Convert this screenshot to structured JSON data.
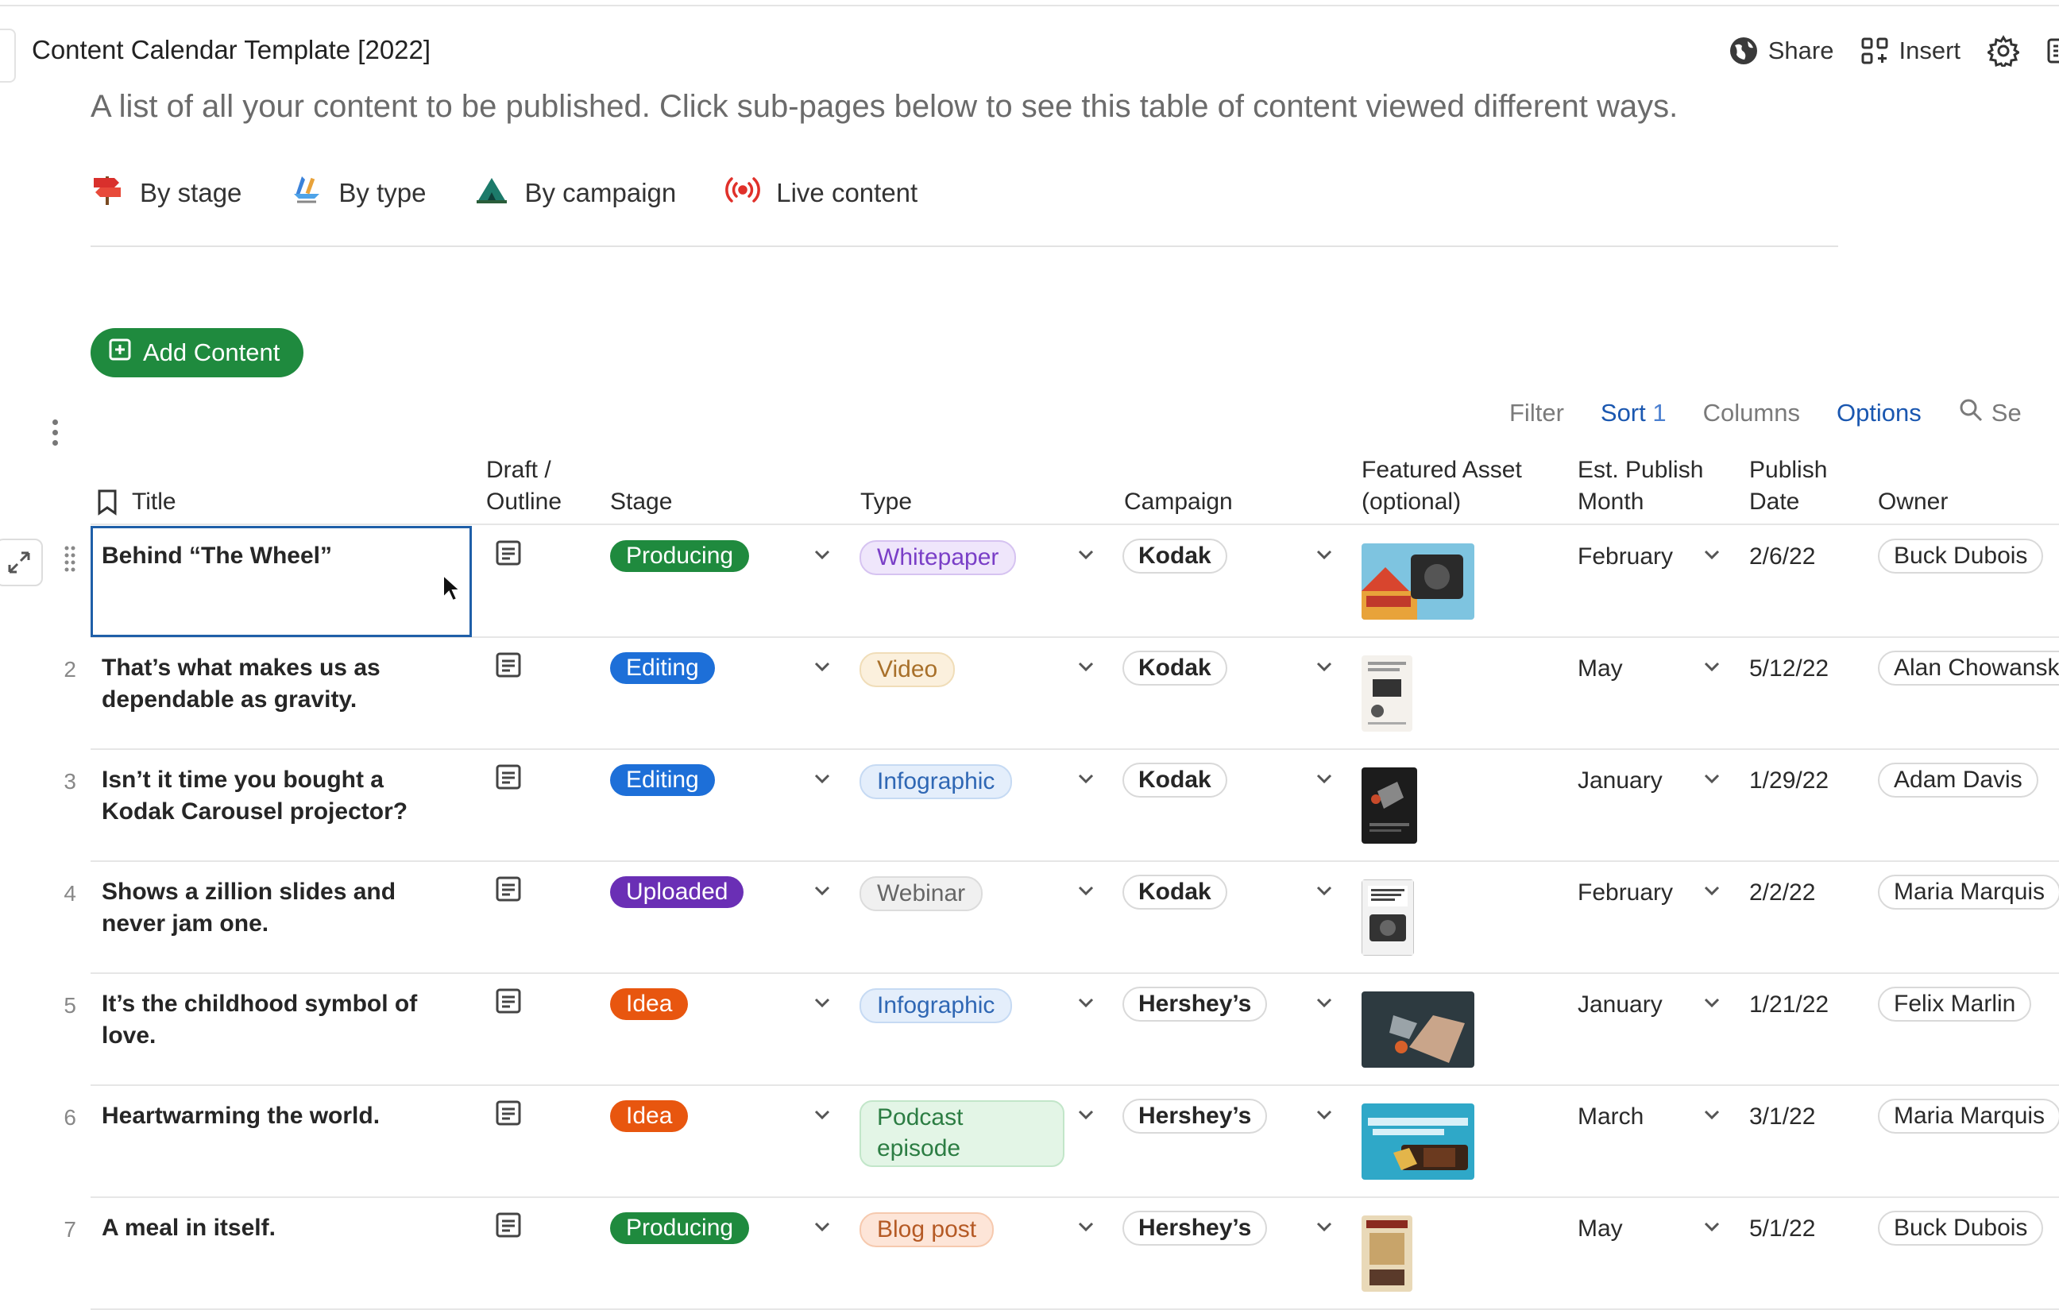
{
  "header": {
    "title": "Content Calendar Template [2022]",
    "share_label": "Share",
    "insert_label": "Insert"
  },
  "subtitle": "A list of all your content to be published. Click sub-pages below to see this table of content viewed different ways.",
  "views": [
    {
      "label": "By stage",
      "icon": "signpost-icon"
    },
    {
      "label": "By type",
      "icon": "tools-icon"
    },
    {
      "label": "By campaign",
      "icon": "tent-icon"
    },
    {
      "label": "Live content",
      "icon": "broadcast-icon"
    }
  ],
  "add_button_label": "Add Content",
  "toolbar": {
    "filter": "Filter",
    "sort": "Sort",
    "sort_count": "1",
    "columns": "Columns",
    "options": "Options",
    "search": "Se"
  },
  "columns": {
    "title": "Title",
    "draft_1": "Draft /",
    "draft_2": "Outline",
    "stage": "Stage",
    "type": "Type",
    "campaign": "Campaign",
    "asset_1": "Featured Asset",
    "asset_2": "(optional)",
    "month_1": "Est. Publish",
    "month_2": "Month",
    "date_1": "Publish",
    "date_2": "Date",
    "owner": "Owner"
  },
  "rows": [
    {
      "num": "",
      "title": "Behind “The Wheel”",
      "stage": "Producing",
      "type": "Whitepaper",
      "campaign": "Kodak",
      "month": "February",
      "date": "2/6/22",
      "owner": "Buck Dubois"
    },
    {
      "num": "2",
      "title": "That’s what makes us as dependable as gravity.",
      "stage": "Editing",
      "type": "Video",
      "campaign": "Kodak",
      "month": "May",
      "date": "5/12/22",
      "owner": "Alan Chowansky"
    },
    {
      "num": "3",
      "title": "Isn’t it time you bought a Kodak Carousel projector?",
      "stage": "Editing",
      "type": "Infographic",
      "campaign": "Kodak",
      "month": "January",
      "date": "1/29/22",
      "owner": "Adam Davis"
    },
    {
      "num": "4",
      "title": "Shows a zillion slides and never jam one.",
      "stage": "Uploaded",
      "type": "Webinar",
      "campaign": "Kodak",
      "month": "February",
      "date": "2/2/22",
      "owner": "Maria Marquis"
    },
    {
      "num": "5",
      "title": "It’s the childhood symbol of love.",
      "stage": "Idea",
      "type": "Infographic",
      "campaign": "Hershey’s",
      "month": "January",
      "date": "1/21/22",
      "owner": "Felix Marlin"
    },
    {
      "num": "6",
      "title": "Heartwarming the world.",
      "stage": "Idea",
      "type": "Podcast episode",
      "campaign": "Hershey’s",
      "month": "March",
      "date": "3/1/22",
      "owner": "Maria Marquis"
    },
    {
      "num": "7",
      "title": "A meal in itself.",
      "stage": "Producing",
      "type": "Blog post",
      "campaign": "Hershey’s",
      "month": "May",
      "date": "5/1/22",
      "owner": "Buck Dubois"
    }
  ],
  "colors": {
    "stage": {
      "Producing": {
        "bg": "#1f8a3e",
        "fg": "#ffffff"
      },
      "Editing": {
        "bg": "#1d6fd8",
        "fg": "#ffffff"
      },
      "Uploaded": {
        "bg": "#6a2fb5",
        "fg": "#ffffff"
      },
      "Idea": {
        "bg": "#e8560f",
        "fg": "#ffffff"
      }
    },
    "type": {
      "Whitepaper": {
        "bg": "#efe6fb",
        "fg": "#7a3fc7",
        "border": "#d6c3f1"
      },
      "Video": {
        "bg": "#fbf0dd",
        "fg": "#a8702a",
        "border": "#f0ddb8"
      },
      "Infographic": {
        "bg": "#e4eefb",
        "fg": "#2f67b4",
        "border": "#c6daf3"
      },
      "Webinar": {
        "bg": "#f0f0f0",
        "fg": "#666666",
        "border": "#dcdcdc"
      },
      "Podcast episode": {
        "bg": "#e3f5e6",
        "fg": "#2c7d43",
        "border": "#c2e6c9"
      },
      "Blog post": {
        "bg": "#fde5d8",
        "fg": "#b55a25",
        "border": "#f6c9ae"
      }
    }
  }
}
